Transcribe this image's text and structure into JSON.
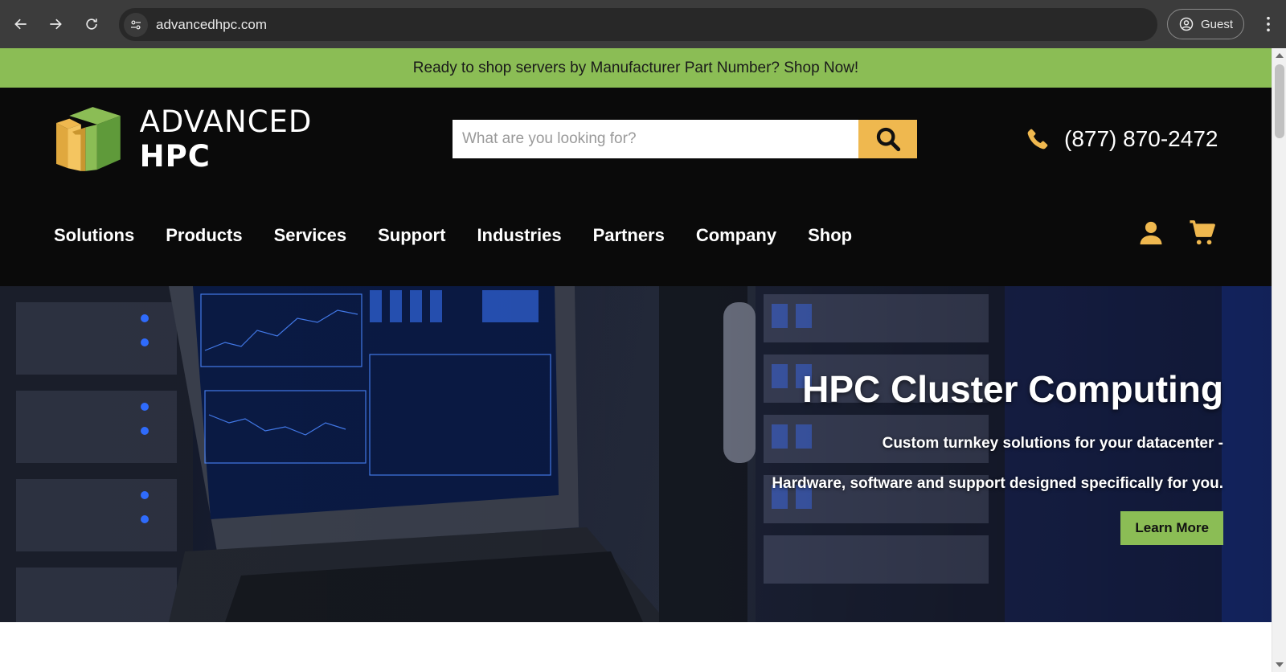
{
  "browser": {
    "url": "advancedhpc.com",
    "profile_label": "Guest"
  },
  "announcement": {
    "text": "Ready to shop servers by Manufacturer Part Number? Shop Now!"
  },
  "header": {
    "logo_text_light": "ADVANCED ",
    "logo_text_bold": "HPC",
    "search_placeholder": "What are you looking for?",
    "phone": "(877) 870-2472"
  },
  "nav": {
    "items": [
      {
        "label": "Solutions"
      },
      {
        "label": "Products"
      },
      {
        "label": "Services"
      },
      {
        "label": "Support"
      },
      {
        "label": "Industries"
      },
      {
        "label": "Partners"
      },
      {
        "label": "Company"
      },
      {
        "label": "Shop"
      }
    ],
    "icons": [
      "user-icon",
      "cart-icon"
    ]
  },
  "hero": {
    "title": "HPC Cluster Computing",
    "subtitle_line1": "Custom turnkey solutions for your datacenter -",
    "subtitle_line2": "Hardware, software and support designed specifically for you.",
    "cta_label": "Learn More"
  },
  "colors": {
    "accent_green": "#8bbd55",
    "accent_gold": "#efb84f",
    "header_bg": "#0a0a0a",
    "chrome_bg": "#3c3c3c"
  }
}
